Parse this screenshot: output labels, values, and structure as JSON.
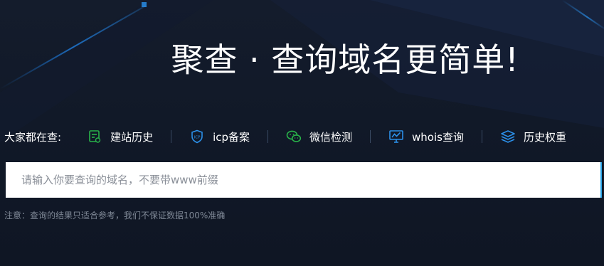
{
  "headline": "聚查 · 查询域名更简单!",
  "hot": {
    "label": "大家都在查:",
    "items": [
      {
        "label": "建站历史",
        "icon": "site-history-icon",
        "color": "#29b34a"
      },
      {
        "label": "icp备案",
        "icon": "icp-shield-icon",
        "color": "#2b8fe8"
      },
      {
        "label": "微信检测",
        "icon": "wechat-icon",
        "color": "#29b34a"
      },
      {
        "label": "whois查询",
        "icon": "monitor-chart-icon",
        "color": "#2b8fe8"
      },
      {
        "label": "历史权重",
        "icon": "layers-icon",
        "color": "#2b8fe8"
      }
    ]
  },
  "search": {
    "value": "",
    "placeholder": "请输入你要查询的域名，不要带www前缀"
  },
  "notice": "注意：查询的结果只适合参考，我们不保证数据100%准确",
  "colors": {
    "background": "#0f1726",
    "accent_blue": "#2b8fe8",
    "accent_green": "#29b34a",
    "search_border": "#27a3e6"
  }
}
